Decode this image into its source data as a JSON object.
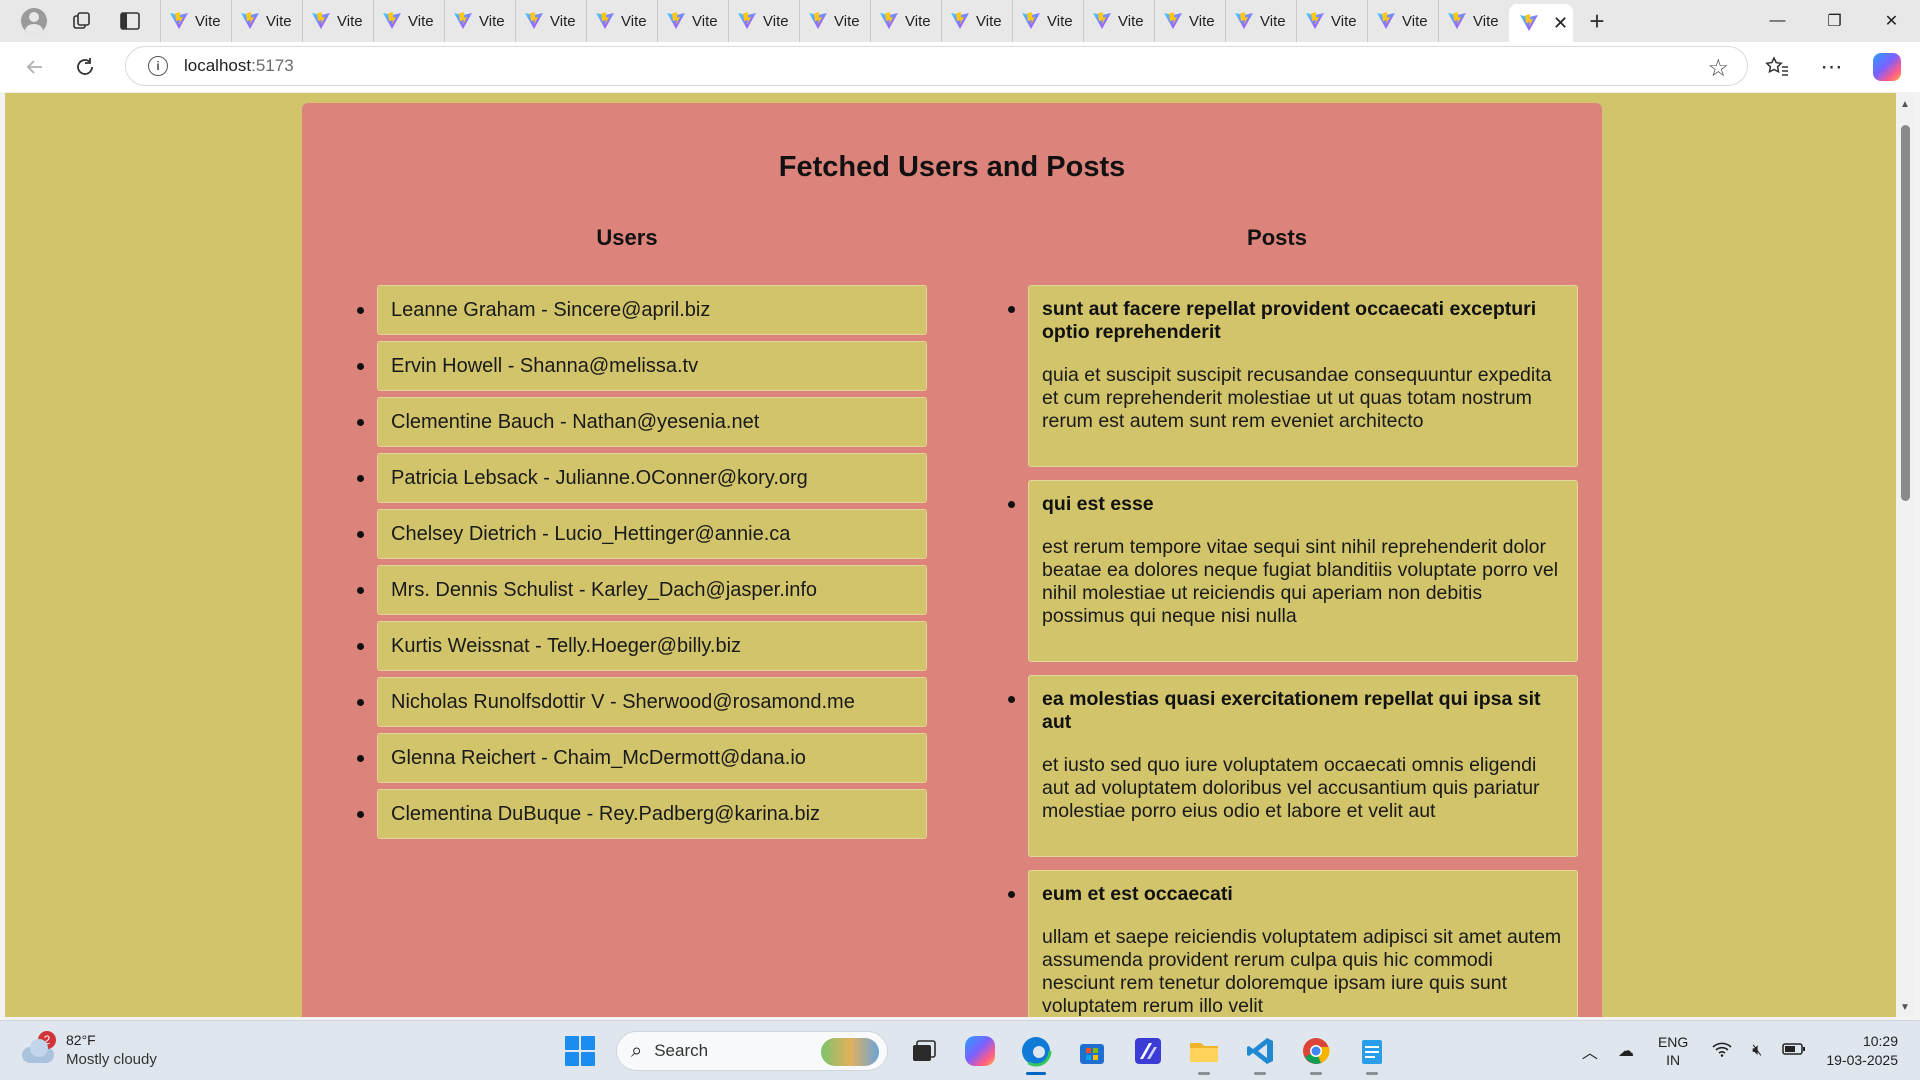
{
  "browser": {
    "tab_label": "Vite",
    "tab_count": 20,
    "active_tab_close": "✕",
    "new_tab": "+",
    "url_host": "localhost",
    "url_port": ":5173",
    "window": {
      "minimize": "—",
      "restore": "❐",
      "close": "✕"
    }
  },
  "page": {
    "title": "Fetched Users and Posts",
    "users_heading": "Users",
    "posts_heading": "Posts",
    "background": "#d1c46b",
    "panel_color": "#dc847c",
    "users": [
      "Leanne Graham - Sincere@april.biz",
      "Ervin Howell - Shanna@melissa.tv",
      "Clementine Bauch - Nathan@yesenia.net",
      "Patricia Lebsack - Julianne.OConner@kory.org",
      "Chelsey Dietrich - Lucio_Hettinger@annie.ca",
      "Mrs. Dennis Schulist - Karley_Dach@jasper.info",
      "Kurtis Weissnat - Telly.Hoeger@billy.biz",
      "Nicholas Runolfsdottir V - Sherwood@rosamond.me",
      "Glenna Reichert - Chaim_McDermott@dana.io",
      "Clementina DuBuque - Rey.Padberg@karina.biz"
    ],
    "posts": [
      {
        "title": "sunt aut facere repellat provident occaecati excepturi optio reprehenderit",
        "body": "quia et suscipit suscipit recusandae consequuntur expedita et cum reprehenderit molestiae ut ut quas totam nostrum rerum est autem sunt rem eveniet architecto"
      },
      {
        "title": "qui est esse",
        "body": "est rerum tempore vitae sequi sint nihil reprehenderit dolor beatae ea dolores neque fugiat blanditiis voluptate porro vel nihil molestiae ut reiciendis qui aperiam non debitis possimus qui neque nisi nulla"
      },
      {
        "title": "ea molestias quasi exercitationem repellat qui ipsa sit aut",
        "body": "et iusto sed quo iure voluptatem occaecati omnis eligendi aut ad voluptatem doloribus vel accusantium quis pariatur molestiae porro eius odio et labore et velit aut"
      },
      {
        "title": "eum et est occaecati",
        "body": "ullam et saepe reiciendis voluptatem adipisci sit amet autem assumenda provident rerum culpa quis hic commodi nesciunt rem tenetur doloremque ipsam iure quis sunt voluptatem rerum illo velit"
      }
    ]
  },
  "taskbar": {
    "weather_badge": "2",
    "temperature": "82°F",
    "condition": "Mostly cloudy",
    "search_label": "Search",
    "language": "ENG",
    "region": "IN",
    "time": "10:29",
    "date": "19-03-2025"
  }
}
